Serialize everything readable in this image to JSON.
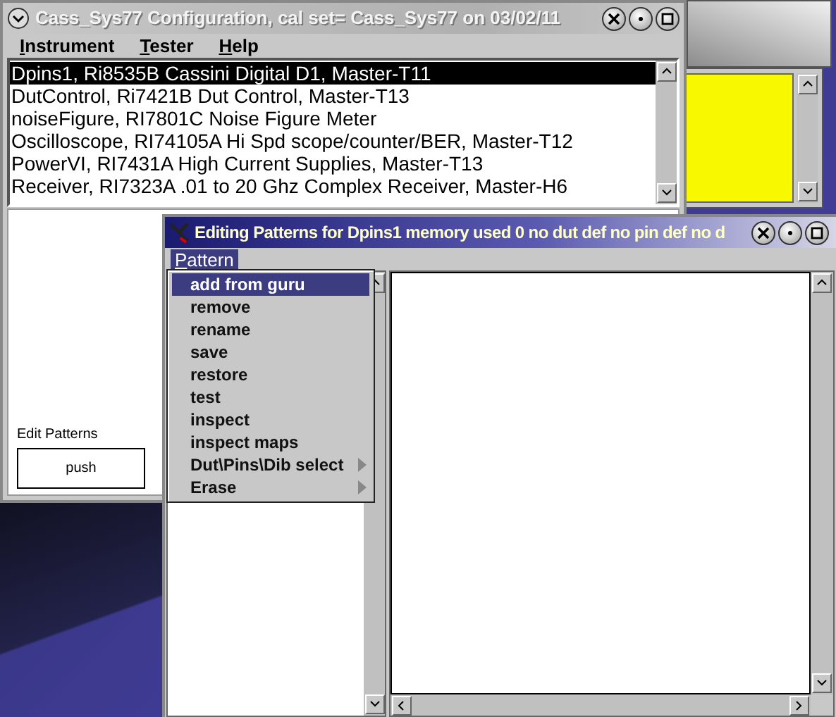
{
  "main_window": {
    "title": "Cass_Sys77 Configuration,  cal set= Cass_Sys77 on 03/02/11",
    "menu": [
      {
        "label": "Instrument"
      },
      {
        "label": "Tester"
      },
      {
        "label": "Help"
      }
    ],
    "instruments": [
      {
        "label": "Dpins1,  Ri8535B Cassini Digital D1, Master-T11",
        "selected": true
      },
      {
        "label": "DutControl,  Ri7421B Dut Control, Master-T13",
        "selected": false
      },
      {
        "label": "noiseFigure,  RI7801C Noise Figure Meter",
        "selected": false
      },
      {
        "label": "Oscilloscope,  RI74105A Hi Spd scope/counter/BER, Master-T12",
        "selected": false
      },
      {
        "label": "PowerVI,  RI7431A High Current Supplies, Master-T13",
        "selected": false
      },
      {
        "label": "Receiver,  RI7323A   .01 to 20 Ghz Complex Receiver, Master-H6",
        "selected": false
      }
    ],
    "edit_patterns": {
      "label": "Edit Patterns",
      "button": "push"
    }
  },
  "pattern_window": {
    "title": "Editing Patterns for Dpins1 memory used 0  no dut def   no pin def   no d",
    "menu": [
      {
        "label": "Pattern",
        "selected": true
      }
    ],
    "dropdown": [
      {
        "label": "add from guru",
        "selected": true,
        "submenu": false
      },
      {
        "label": "remove",
        "selected": false,
        "submenu": false
      },
      {
        "label": "rename",
        "selected": false,
        "submenu": false
      },
      {
        "label": "save",
        "selected": false,
        "submenu": false
      },
      {
        "label": "restore",
        "selected": false,
        "submenu": false
      },
      {
        "label": "test",
        "selected": false,
        "submenu": false
      },
      {
        "label": "inspect",
        "selected": false,
        "submenu": false
      },
      {
        "label": "inspect maps",
        "selected": false,
        "submenu": false
      },
      {
        "label": "Dut\\Pins\\Dib select",
        "selected": false,
        "submenu": true
      },
      {
        "label": "Erase",
        "selected": false,
        "submenu": true
      }
    ]
  }
}
